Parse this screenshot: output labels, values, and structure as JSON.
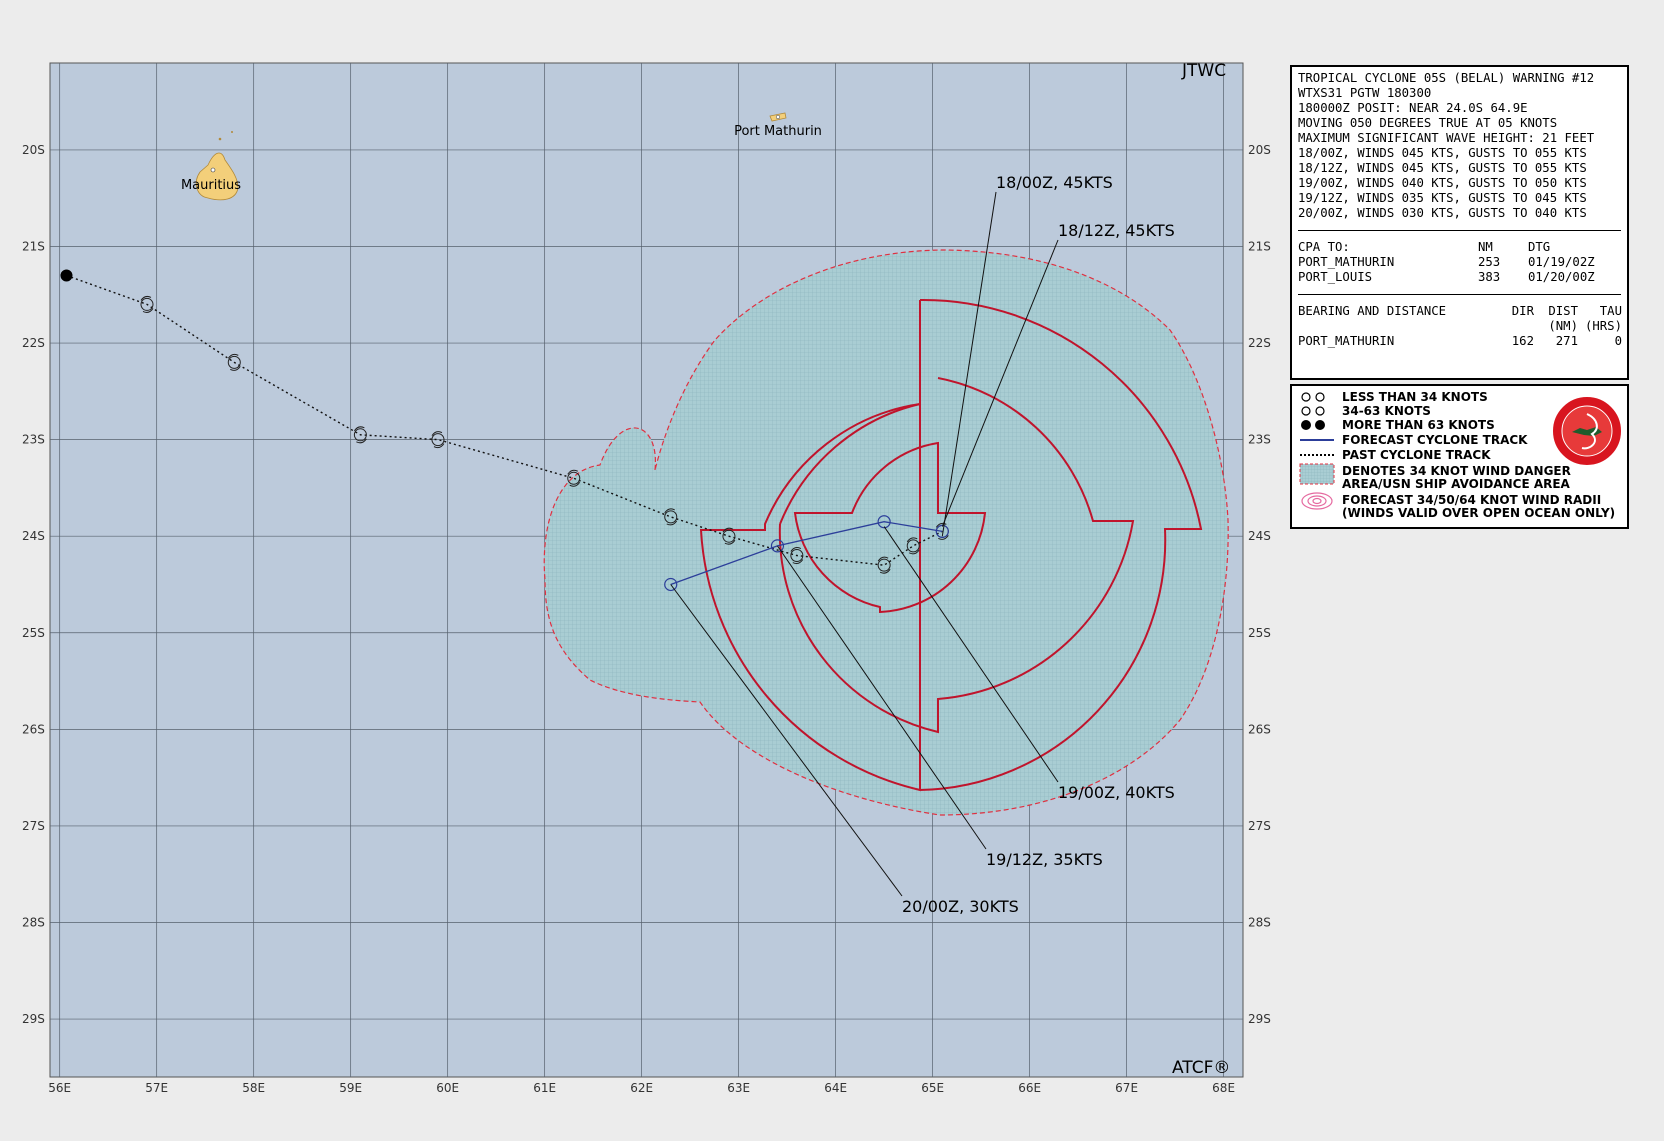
{
  "brand": {
    "top": "JTWC",
    "bottom": "ATCF®"
  },
  "axes": {
    "lon_labels": [
      "56E",
      "57E",
      "58E",
      "59E",
      "60E",
      "61E",
      "62E",
      "63E",
      "64E",
      "65E",
      "66E",
      "67E",
      "68E"
    ],
    "lat_labels": [
      "20S",
      "21S",
      "22S",
      "23S",
      "24S",
      "25S",
      "26S",
      "27S",
      "28S",
      "29S"
    ]
  },
  "places": [
    {
      "name": "Port Mathurin",
      "lon": 63.4,
      "lat": 19.75
    },
    {
      "name": "Mauritius",
      "lon": 57.55,
      "lat": 20.25
    }
  ],
  "forecast_labels": [
    {
      "text": "18/00Z,  45KTS",
      "lon": 65.1,
      "lat": 24.0
    },
    {
      "text": "18/12Z,  45KTS",
      "lon": 65.1,
      "lat": 23.9
    },
    {
      "text": "19/00Z,  40KTS",
      "lon": 64.5,
      "lat": 23.9
    },
    {
      "text": "19/12Z,  35KTS",
      "lon": 63.4,
      "lat": 24.1
    },
    {
      "text": "20/00Z,  30KTS",
      "lon": 62.3,
      "lat": 24.5
    }
  ],
  "chart_data": {
    "type": "map",
    "lon_range": [
      55.9,
      68.2
    ],
    "lat_range": [
      19.1,
      29.6
    ],
    "past_track": [
      [
        56.07,
        21.3
      ],
      [
        56.9,
        21.6
      ],
      [
        57.8,
        22.2
      ],
      [
        59.1,
        22.95
      ],
      [
        59.9,
        23.0
      ],
      [
        61.3,
        23.4
      ],
      [
        62.3,
        23.8
      ],
      [
        62.9,
        24.0
      ],
      [
        63.6,
        24.2
      ],
      [
        64.5,
        24.3
      ],
      [
        64.8,
        24.1
      ],
      [
        65.1,
        23.95
      ]
    ],
    "forecast_track": [
      [
        65.1,
        23.95
      ],
      [
        64.5,
        23.85
      ],
      [
        63.4,
        24.1
      ],
      [
        62.3,
        24.5
      ]
    ],
    "colors": {
      "ocean": "#bccadb",
      "danger": "#a9cdd3",
      "radii": "#c0142c",
      "forecast_track": "#2c3e9a",
      "land": "#f3cf7a"
    }
  },
  "warning": {
    "lines": [
      "TROPICAL CYCLONE 05S (BELAL) WARNING #12",
      "WTXS31 PGTW 180300",
      "180000Z POSIT: NEAR 24.0S 64.9E",
      "MOVING 050 DEGREES TRUE AT 05 KNOTS",
      "MAXIMUM SIGNIFICANT WAVE HEIGHT: 21 FEET",
      "18/00Z, WINDS 045 KTS, GUSTS TO 055 KTS",
      "18/12Z, WINDS 045 KTS, GUSTS TO 055 KTS",
      "19/00Z, WINDS 040 KTS, GUSTS TO 050 KTS",
      "19/12Z, WINDS 035 KTS, GUSTS TO 045 KTS",
      "20/00Z, WINDS 030 KTS, GUSTS TO 040 KTS"
    ],
    "cpa": {
      "header": [
        "CPA TO:",
        "NM",
        "DTG"
      ],
      "rows": [
        [
          "PORT_MATHURIN",
          "253",
          "01/19/02Z"
        ],
        [
          "PORT_LOUIS",
          "383",
          "01/20/00Z"
        ]
      ]
    },
    "bearing": {
      "header": [
        "BEARING AND DISTANCE",
        "DIR",
        "DIST",
        "TAU"
      ],
      "subheader": [
        "",
        "",
        "(NM)",
        "(HRS)"
      ],
      "rows": [
        [
          "PORT_MATHURIN",
          "162",
          "271",
          "0"
        ]
      ]
    }
  },
  "legend": {
    "items": [
      "LESS THAN 34 KNOTS",
      "34-63 KNOTS",
      "MORE THAN 63 KNOTS",
      "FORECAST CYCLONE TRACK",
      "PAST CYCLONE TRACK",
      "DENOTES 34 KNOT WIND DANGER",
      "AREA/USN SHIP AVOIDANCE AREA",
      "FORECAST 34/50/64 KNOT WIND RADII",
      "(WINDS VALID OVER OPEN OCEAN ONLY)"
    ]
  }
}
